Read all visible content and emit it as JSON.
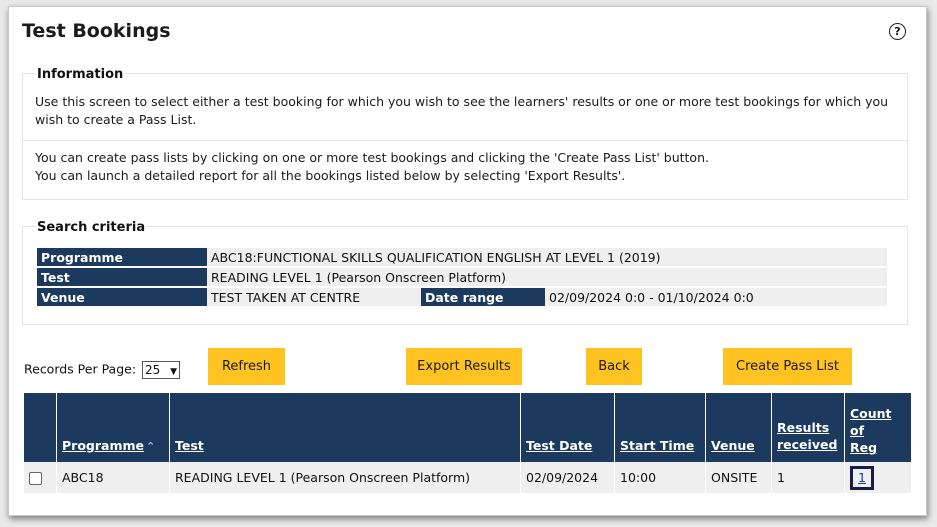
{
  "title": "Test Bookings",
  "help_icon": "?",
  "information": {
    "legend": "Information",
    "para1": "Use this screen to select either a test booking for which you wish to see the learners' results or one or more test bookings for which you wish to create a Pass List.",
    "para2a": "You can create pass lists by clicking on one or more test bookings and clicking the 'Create Pass List' button.",
    "para2b": "You can launch a detailed report for all the bookings listed below by selecting 'Export Results'."
  },
  "criteria": {
    "legend": "Search criteria",
    "programme_label": "Programme",
    "programme_value": "ABC18:FUNCTIONAL SKILLS QUALIFICATION ENGLISH AT LEVEL 1 (2019)",
    "test_label": "Test",
    "test_value": "READING LEVEL 1 (Pearson Onscreen Platform)",
    "venue_label": "Venue",
    "venue_value": "TEST TAKEN AT CENTRE",
    "date_label": "Date range",
    "date_value": "02/09/2024 0:0 - 01/10/2024 0:0"
  },
  "toolbar": {
    "rpp_label": "Records Per Page:",
    "rpp_value": "25",
    "refresh": "Refresh",
    "export": "Export Results",
    "back": "Back",
    "create": "Create Pass List"
  },
  "table": {
    "headers": {
      "programme": "Programme",
      "sort_icon": "^",
      "test": "Test",
      "test_date": "Test Date",
      "start_time": "Start Time",
      "venue": "Venue",
      "results_1": "Results",
      "results_2": "received",
      "count_1": "Count",
      "count_2": "of",
      "count_3": "Reg"
    },
    "rows": [
      {
        "programme": "ABC18",
        "test": "READING LEVEL 1 (Pearson Onscreen Platform)",
        "test_date": "02/09/2024",
        "start_time": "10:00",
        "venue": "ONSITE",
        "results": "1",
        "count": "1"
      }
    ]
  }
}
